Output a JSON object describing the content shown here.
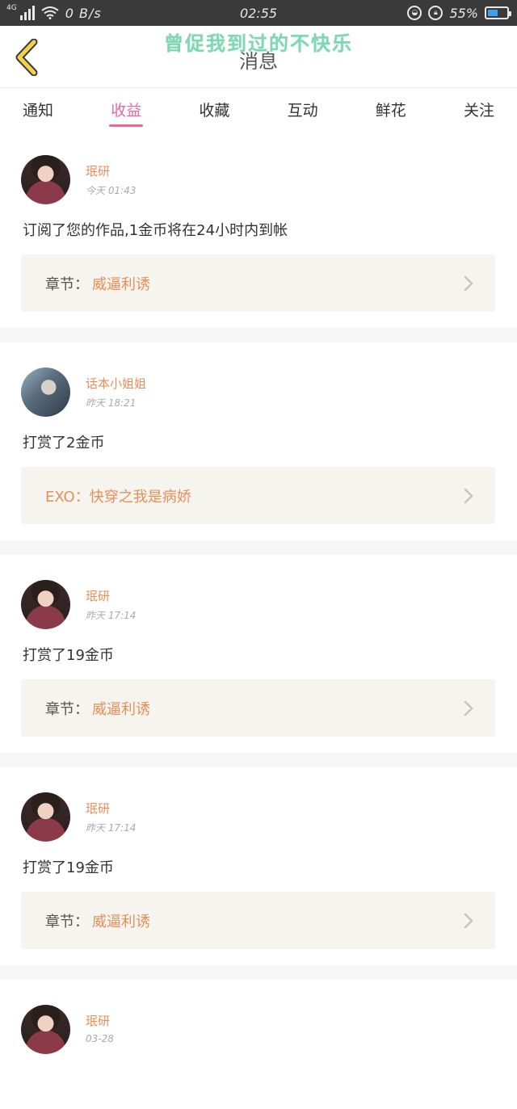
{
  "status_bar": {
    "network": "4G",
    "speed": "0 B/s",
    "time": "02:55",
    "battery": "55%",
    "battery_level": 0.55
  },
  "header": {
    "title": "消息",
    "watermark": "曾促我到过的不快乐"
  },
  "tabs": [
    {
      "label": "通知",
      "active": false
    },
    {
      "label": "收益",
      "active": true
    },
    {
      "label": "收藏",
      "active": false
    },
    {
      "label": "互动",
      "active": false
    },
    {
      "label": "鲜花",
      "active": false
    },
    {
      "label": "关注",
      "active": false
    }
  ],
  "messages": [
    {
      "user": "珉研",
      "time": "今天 01:43",
      "text": "订阅了您的作品,1金币将在24小时内到帐",
      "link_label": "章节：",
      "link_value": "威逼利诱"
    },
    {
      "user": "话本小姐姐",
      "time": "昨天 18:21",
      "text": "打赏了2金币",
      "link_label": "",
      "link_value": "EXO：快穿之我是病娇"
    },
    {
      "user": "珉研",
      "time": "昨天 17:14",
      "text": "打赏了19金币",
      "link_label": "章节：",
      "link_value": "威逼利诱"
    },
    {
      "user": "珉研",
      "time": "昨天 17:14",
      "text": "打赏了19金币",
      "link_label": "章节：",
      "link_value": "威逼利诱"
    },
    {
      "user": "珉研",
      "time": "03-28"
    }
  ],
  "colors": {
    "accent": "#e46aa0",
    "username": "#e88e5a",
    "link_box": "#f5f4ee",
    "back_arrow": "#f2d24a"
  }
}
